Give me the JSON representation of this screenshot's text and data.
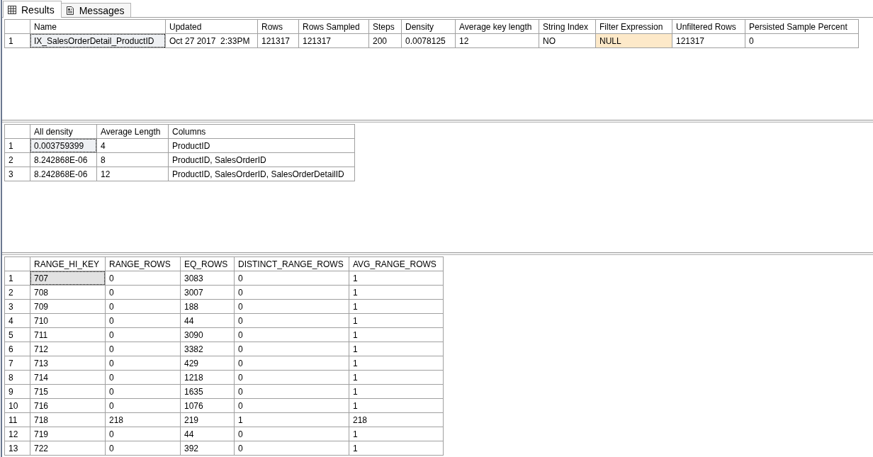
{
  "tabs": [
    {
      "label": "Results",
      "selected": true
    },
    {
      "label": "Messages",
      "selected": false
    }
  ],
  "grids": [
    {
      "focused": false,
      "columns": [
        "Name",
        "Updated",
        "Rows",
        "Rows Sampled",
        "Steps",
        "Density",
        "Average key length",
        "String Index",
        "Filter Expression",
        "Unfiltered Rows",
        "Persisted Sample Percent"
      ],
      "rows": [
        {
          "number": "1",
          "cells": [
            {
              "text": "IX_SalesOrderDetail_ProductID",
              "selected": true,
              "kind": "value"
            },
            {
              "text": "Oct 27 2017  2:33PM",
              "selected": false,
              "kind": "value"
            },
            {
              "text": "121317",
              "selected": false,
              "kind": "value"
            },
            {
              "text": "121317",
              "selected": false,
              "kind": "value"
            },
            {
              "text": "200",
              "selected": false,
              "kind": "value"
            },
            {
              "text": "0.0078125",
              "selected": false,
              "kind": "value"
            },
            {
              "text": "12",
              "selected": false,
              "kind": "value"
            },
            {
              "text": "NO",
              "selected": false,
              "kind": "value"
            },
            {
              "text": "NULL",
              "selected": false,
              "kind": "null"
            },
            {
              "text": "121317",
              "selected": false,
              "kind": "value"
            },
            {
              "text": "0",
              "selected": false,
              "kind": "value"
            }
          ]
        }
      ]
    },
    {
      "focused": false,
      "columns": [
        "All density",
        "Average Length",
        "Columns"
      ],
      "rows": [
        {
          "number": "1",
          "cells": [
            {
              "text": "0.003759399",
              "selected": true
            },
            {
              "text": "4",
              "selected": false
            },
            {
              "text": "ProductID",
              "selected": false
            }
          ]
        },
        {
          "number": "2",
          "cells": [
            {
              "text": "8.242868E-06",
              "selected": false
            },
            {
              "text": "8",
              "selected": false
            },
            {
              "text": "ProductID, SalesOrderID",
              "selected": false
            }
          ]
        },
        {
          "number": "3",
          "cells": [
            {
              "text": "8.242868E-06",
              "selected": false
            },
            {
              "text": "12",
              "selected": false
            },
            {
              "text": "ProductID, SalesOrderID, SalesOrderDetailID",
              "selected": false
            }
          ]
        }
      ]
    },
    {
      "focused": true,
      "columns": [
        "RANGE_HI_KEY",
        "RANGE_ROWS",
        "EQ_ROWS",
        "DISTINCT_RANGE_ROWS",
        "AVG_RANGE_ROWS"
      ],
      "rows": [
        {
          "number": "1",
          "cells": [
            {
              "text": "707",
              "selected": true
            },
            {
              "text": "0",
              "selected": false
            },
            {
              "text": "3083",
              "selected": false
            },
            {
              "text": "0",
              "selected": false
            },
            {
              "text": "1",
              "selected": false
            }
          ]
        },
        {
          "number": "2",
          "cells": [
            {
              "text": "708",
              "selected": false
            },
            {
              "text": "0",
              "selected": false
            },
            {
              "text": "3007",
              "selected": false
            },
            {
              "text": "0",
              "selected": false
            },
            {
              "text": "1",
              "selected": false
            }
          ]
        },
        {
          "number": "3",
          "cells": [
            {
              "text": "709",
              "selected": false
            },
            {
              "text": "0",
              "selected": false
            },
            {
              "text": "188",
              "selected": false
            },
            {
              "text": "0",
              "selected": false
            },
            {
              "text": "1",
              "selected": false
            }
          ]
        },
        {
          "number": "4",
          "cells": [
            {
              "text": "710",
              "selected": false
            },
            {
              "text": "0",
              "selected": false
            },
            {
              "text": "44",
              "selected": false
            },
            {
              "text": "0",
              "selected": false
            },
            {
              "text": "1",
              "selected": false
            }
          ]
        },
        {
          "number": "5",
          "cells": [
            {
              "text": "711",
              "selected": false
            },
            {
              "text": "0",
              "selected": false
            },
            {
              "text": "3090",
              "selected": false
            },
            {
              "text": "0",
              "selected": false
            },
            {
              "text": "1",
              "selected": false
            }
          ]
        },
        {
          "number": "6",
          "cells": [
            {
              "text": "712",
              "selected": false
            },
            {
              "text": "0",
              "selected": false
            },
            {
              "text": "3382",
              "selected": false
            },
            {
              "text": "0",
              "selected": false
            },
            {
              "text": "1",
              "selected": false
            }
          ]
        },
        {
          "number": "7",
          "cells": [
            {
              "text": "713",
              "selected": false
            },
            {
              "text": "0",
              "selected": false
            },
            {
              "text": "429",
              "selected": false
            },
            {
              "text": "0",
              "selected": false
            },
            {
              "text": "1",
              "selected": false
            }
          ]
        },
        {
          "number": "8",
          "cells": [
            {
              "text": "714",
              "selected": false
            },
            {
              "text": "0",
              "selected": false
            },
            {
              "text": "1218",
              "selected": false
            },
            {
              "text": "0",
              "selected": false
            },
            {
              "text": "1",
              "selected": false
            }
          ]
        },
        {
          "number": "9",
          "cells": [
            {
              "text": "715",
              "selected": false
            },
            {
              "text": "0",
              "selected": false
            },
            {
              "text": "1635",
              "selected": false
            },
            {
              "text": "0",
              "selected": false
            },
            {
              "text": "1",
              "selected": false
            }
          ]
        },
        {
          "number": "10",
          "cells": [
            {
              "text": "716",
              "selected": false
            },
            {
              "text": "0",
              "selected": false
            },
            {
              "text": "1076",
              "selected": false
            },
            {
              "text": "0",
              "selected": false
            },
            {
              "text": "1",
              "selected": false
            }
          ]
        },
        {
          "number": "11",
          "cells": [
            {
              "text": "718",
              "selected": false
            },
            {
              "text": "218",
              "selected": false
            },
            {
              "text": "219",
              "selected": false
            },
            {
              "text": "1",
              "selected": false
            },
            {
              "text": "218",
              "selected": false
            }
          ]
        },
        {
          "number": "12",
          "cells": [
            {
              "text": "719",
              "selected": false
            },
            {
              "text": "0",
              "selected": false
            },
            {
              "text": "44",
              "selected": false
            },
            {
              "text": "0",
              "selected": false
            },
            {
              "text": "1",
              "selected": false
            }
          ]
        },
        {
          "number": "13",
          "cells": [
            {
              "text": "722",
              "selected": false
            },
            {
              "text": "0",
              "selected": false
            },
            {
              "text": "392",
              "selected": false
            },
            {
              "text": "0",
              "selected": false
            },
            {
              "text": "1",
              "selected": false
            }
          ]
        }
      ]
    }
  ]
}
